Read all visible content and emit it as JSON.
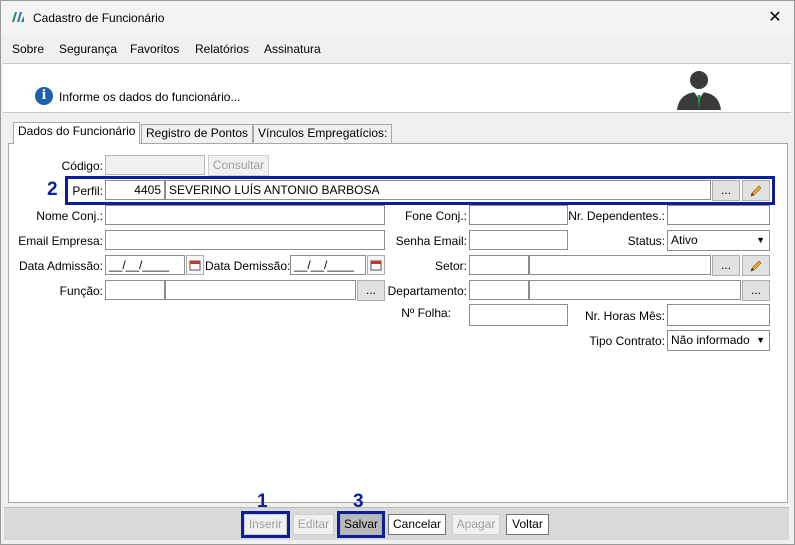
{
  "window": {
    "title": "Cadastro de Funcionário"
  },
  "menu": [
    "Sobre",
    "Segurança",
    "Favoritos",
    "Relatórios",
    "Assinatura"
  ],
  "header": {
    "message": "Informe os dados do funcionário..."
  },
  "tabs": [
    "Dados do Funcionário",
    "Registro de Pontos",
    "Vínculos Empregatícios:"
  ],
  "form": {
    "codigo": {
      "label": "Código:",
      "value": ""
    },
    "consultar_label": "Consultar",
    "perfil": {
      "label": "Perfil:",
      "code": "4405",
      "name": "SEVERINO LUÍS ANTONIO BARBOSA"
    },
    "nome_conj": {
      "label": "Nome Conj.:",
      "value": ""
    },
    "fone_conj": {
      "label": "Fone Conj.:",
      "value": ""
    },
    "nr_dependentes": {
      "label": "Nr. Dependentes.:",
      "value": ""
    },
    "email_empresa": {
      "label": "Email Empresa:",
      "value": ""
    },
    "senha_email": {
      "label": "Senha Email:",
      "value": ""
    },
    "status": {
      "label": "Status:",
      "value": "Ativo"
    },
    "data_admissao": {
      "label": "Data Admissão:",
      "value": "__/__/____"
    },
    "data_demissao": {
      "label": "Data Demissão:",
      "value": "__/__/____"
    },
    "setor": {
      "label": "Setor:",
      "code": "",
      "name": ""
    },
    "funcao": {
      "label": "Função:",
      "code": "",
      "name": ""
    },
    "departamento": {
      "label": "Departamento:",
      "code": "",
      "name": ""
    },
    "n_folha": {
      "label": "Nº Folha:",
      "value": ""
    },
    "nr_horas_mes": {
      "label": "Nr. Horas Mês:",
      "value": ""
    },
    "tipo_contrato": {
      "label": "Tipo Contrato:",
      "value": "Não informado"
    },
    "ellipsis": "...",
    "edit_icon": "pencil-icon",
    "calendar_icon": "calendar-icon"
  },
  "buttons": {
    "inserir": "Inserir",
    "editar": "Editar",
    "salvar": "Salvar",
    "cancelar": "Cancelar",
    "apagar": "Apagar",
    "voltar": "Voltar"
  },
  "annotations": {
    "n1": "1",
    "n2": "2",
    "n3": "3",
    "color": "#0b1f9c"
  }
}
